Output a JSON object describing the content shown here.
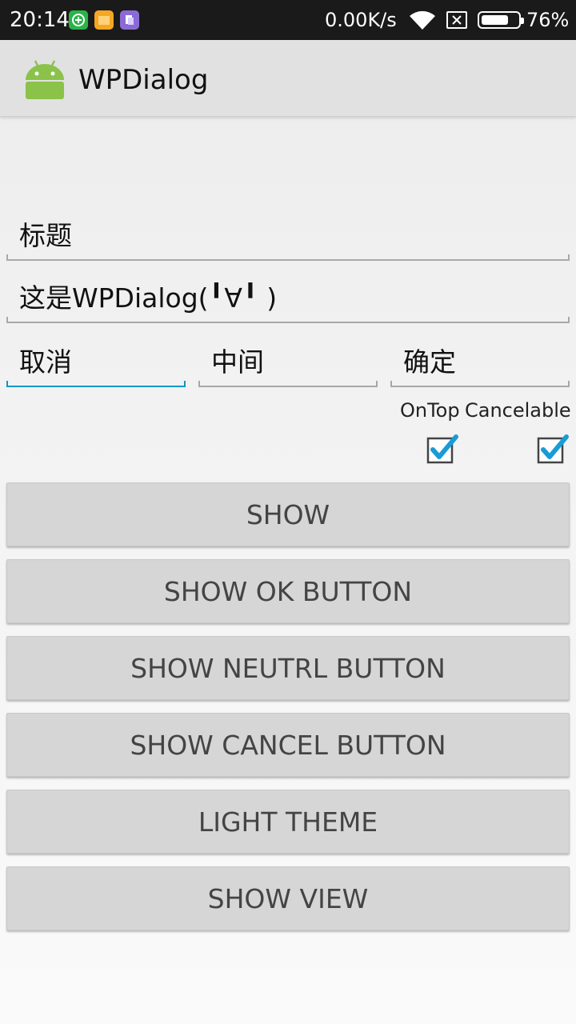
{
  "status_bar": {
    "time": "20:14",
    "speed": "0.00K/s",
    "battery_percent_text": "76%",
    "battery_level": 0.76,
    "icons": [
      "add-app-icon",
      "folder-icon",
      "clipboard-icon",
      "wifi-icon",
      "sim-off-icon",
      "battery-icon"
    ]
  },
  "action_bar": {
    "app_icon": "android-icon",
    "title": "WPDialog"
  },
  "form": {
    "title_field": "标题",
    "message_field": "这是WPDialog(╹∀╹ )",
    "cancel_field": "取消",
    "neutral_field": "中间",
    "ok_field": "确定",
    "on_top_label": "OnTop",
    "cancelable_label": "Cancelable",
    "on_top_checked": true,
    "cancelable_checked": true
  },
  "buttons": {
    "show": "SHOW",
    "show_ok": "SHOW OK BUTTON",
    "show_neutral": "SHOW NEUTRL BUTTON",
    "show_cancel": "SHOW CANCEL BUTTON",
    "light_theme": "LIGHT THEME",
    "show_view": "SHOW VIEW"
  },
  "colors": {
    "accent": "#0c98c5",
    "checkbox": "#1a9bd6",
    "button_bg": "#d6d6d6",
    "action_bar_bg": "#e1e1e1"
  }
}
